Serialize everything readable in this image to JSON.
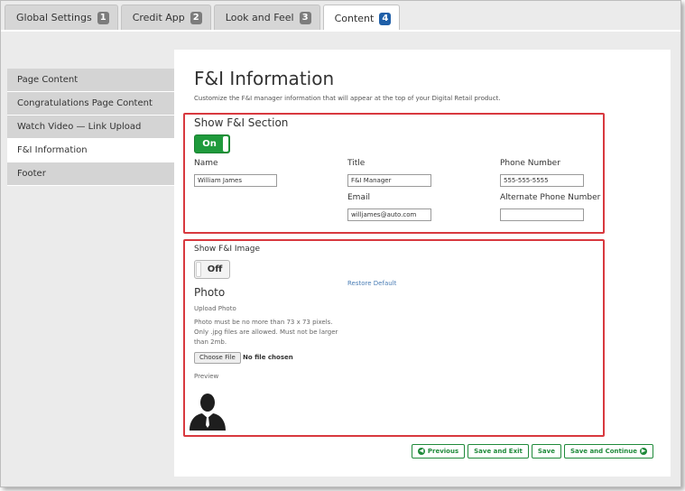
{
  "tabs": [
    {
      "label": "Global Settings",
      "badge": "1"
    },
    {
      "label": "Credit App",
      "badge": "2"
    },
    {
      "label": "Look and Feel",
      "badge": "3"
    },
    {
      "label": "Content",
      "badge": "4"
    }
  ],
  "sidebar": {
    "items": [
      {
        "label": "Page Content"
      },
      {
        "label": "Congratulations Page Content"
      },
      {
        "label": "Watch Video — Link Upload"
      },
      {
        "label": "F&I Information"
      },
      {
        "label": "Footer"
      }
    ]
  },
  "main": {
    "title": "F&I Information",
    "description": "Customize the F&I manager information that will appear at the top of your Digital Retail product."
  },
  "section1": {
    "title": "Show F&I Section",
    "toggle": "On",
    "name_label": "Name",
    "name_value": "William James",
    "title_label": "Title",
    "title_value": "F&I Manager",
    "phone_label": "Phone Number",
    "phone_value": "555-555-5555",
    "email_label": "Email",
    "email_value": "willjames@auto.com",
    "alt_phone_label": "Alternate Phone Number",
    "alt_phone_value": ""
  },
  "section2": {
    "title": "Show F&I Image",
    "toggle": "Off",
    "restore_default": "Restore Default",
    "photo_heading": "Photo",
    "upload_label": "Upload Photo",
    "photo_help": "Photo must be no more than 73 x 73 pixels. Only .jpg files are allowed. Must not be larger than 2mb.",
    "choose_file": "Choose File",
    "no_file": "No file chosen",
    "preview_label": "Preview"
  },
  "buttons": {
    "previous": "Previous",
    "save_exit": "Save and Exit",
    "save": "Save",
    "save_continue": "Save and Continue"
  },
  "colors": {
    "accent_green": "#1f9a3c",
    "highlight_red": "#d8393f",
    "active_badge": "#1f5fa8"
  }
}
